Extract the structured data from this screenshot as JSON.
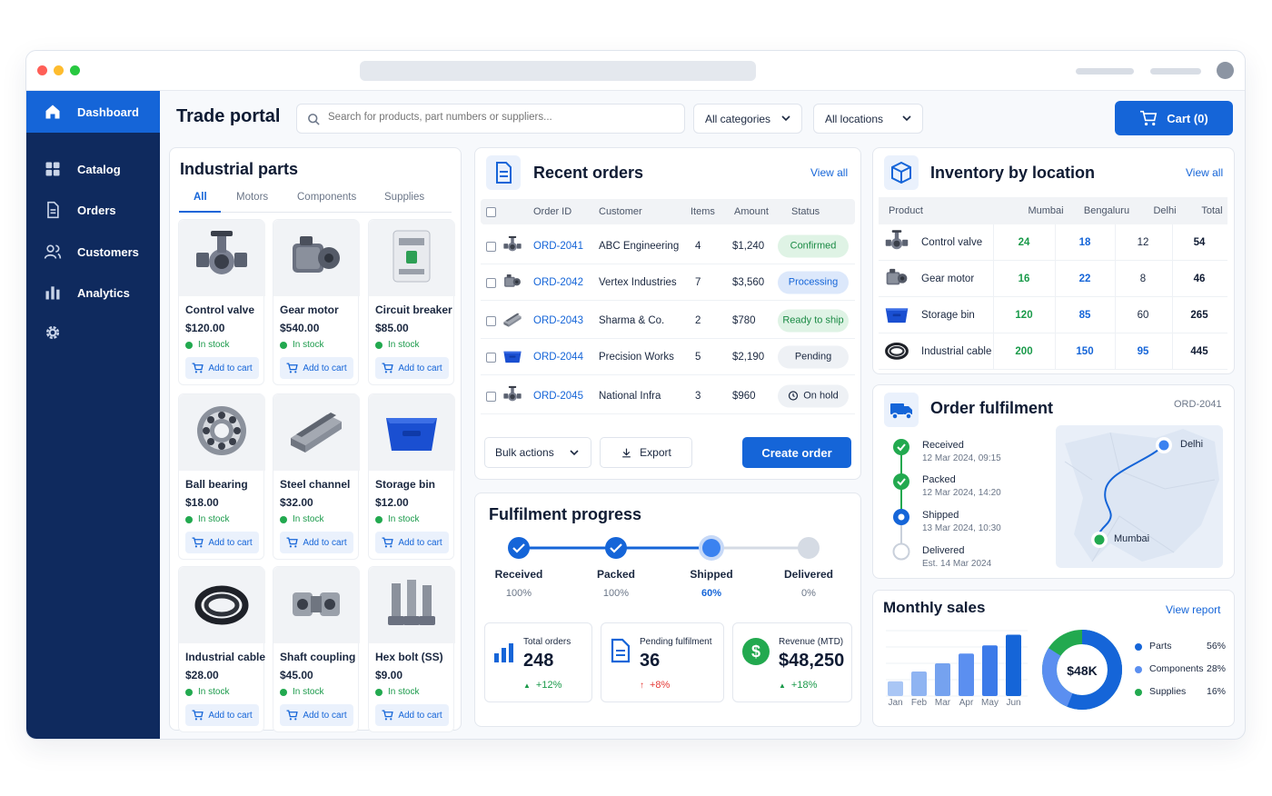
{
  "app": {
    "title": "Trade portal"
  },
  "search": {
    "placeholder": "Search for products, part numbers or suppliers..."
  },
  "filters": {
    "category": "All categories",
    "location": "All locations"
  },
  "cart": {
    "label": "Cart (0)"
  },
  "sidebar": {
    "items": [
      {
        "label": "Dashboard",
        "icon": "home-icon",
        "active": true
      },
      {
        "label": "Catalog",
        "icon": "grid-icon"
      },
      {
        "label": "Orders",
        "icon": "document-icon"
      },
      {
        "label": "Customers",
        "icon": "users-icon"
      },
      {
        "label": "Analytics",
        "icon": "bar-chart-icon"
      },
      {
        "label": "",
        "icon": "gear-icon"
      }
    ]
  },
  "parts": {
    "title": "Industrial parts",
    "tabs": [
      "All",
      "Motors",
      "Components",
      "Supplies"
    ],
    "stock_label": "In stock",
    "add_label": "Add to cart",
    "items": [
      {
        "name": "Control valve",
        "price": "$120.00",
        "icon": "valve-icon"
      },
      {
        "name": "Gear motor",
        "price": "$540.00",
        "icon": "motor-icon"
      },
      {
        "name": "Circuit breaker",
        "price": "$85.00",
        "icon": "breaker-icon"
      },
      {
        "name": "Ball bearing",
        "price": "$18.00",
        "icon": "bearing-icon"
      },
      {
        "name": "Steel channel",
        "price": "$32.00",
        "icon": "steel-channel-icon"
      },
      {
        "name": "Storage bin",
        "price": "$12.00",
        "icon": "storage-bin-icon"
      },
      {
        "name": "Industrial cable",
        "price": "$28.00",
        "icon": "cable-icon"
      },
      {
        "name": "Shaft coupling",
        "price": "$45.00",
        "icon": "coupling-icon"
      },
      {
        "name": "Hex bolt (SS)",
        "price": "$9.00",
        "icon": "bolt-icon"
      }
    ]
  },
  "orders": {
    "title": "Recent orders",
    "view_all": "View all",
    "columns": [
      "Order ID",
      "Customer",
      "Items",
      "Amount",
      "Status"
    ],
    "rows": [
      {
        "id": "ORD-2041",
        "customer": "ABC Engineering",
        "items": "4",
        "amount": "$1,240",
        "status": "Confirmed",
        "icon": "valve-icon"
      },
      {
        "id": "ORD-2042",
        "customer": "Vertex Industries",
        "items": "7",
        "amount": "$3,560",
        "status": "Processing",
        "icon": "motor-icon"
      },
      {
        "id": "ORD-2043",
        "customer": "Sharma & Co.",
        "items": "2",
        "amount": "$780",
        "status": "Ready to ship",
        "icon": "steel-channel-icon"
      },
      {
        "id": "ORD-2044",
        "customer": "Precision Works",
        "items": "5",
        "amount": "$2,190",
        "status": "Pending",
        "icon": "storage-bin-icon"
      },
      {
        "id": "ORD-2045",
        "customer": "National Infra",
        "items": "3",
        "amount": "$960",
        "status": "On hold",
        "icon": "valve-icon"
      }
    ],
    "bulk_label": "Bulk actions",
    "export_label": "Export",
    "create_label": "Create order"
  },
  "inventory": {
    "title": "Inventory by location",
    "view_all": "View all",
    "columns": [
      "Product",
      "Mumbai",
      "Bengaluru",
      "Delhi",
      "Total"
    ],
    "rows": [
      {
        "product": "Control valve",
        "mumbai": "24",
        "bengaluru": "18",
        "delhi": "12",
        "total": "54"
      },
      {
        "product": "Gear motor",
        "mumbai": "16",
        "bengaluru": "22",
        "delhi": "8",
        "total": "46"
      },
      {
        "product": "Storage bin",
        "mumbai": "120",
        "bengaluru": "85",
        "delhi": "60",
        "total": "265"
      },
      {
        "product": "Industrial cable",
        "mumbai": "200",
        "bengaluru": "150",
        "delhi": "95",
        "total": "445"
      }
    ]
  },
  "fulfilment": {
    "title": "Order fulfilment",
    "order_id": "ORD-2041",
    "steps": [
      {
        "name": "Received",
        "date": "12 Mar 2024, 09:15",
        "state": "done"
      },
      {
        "name": "Packed",
        "date": "12 Mar 2024, 14:20",
        "state": "done"
      },
      {
        "name": "Shipped",
        "date": "13 Mar 2024, 10:30",
        "state": "current"
      },
      {
        "name": "Delivered",
        "date": "Est. 14 Mar 2024",
        "state": "pending"
      }
    ],
    "map": {
      "origin": "Mumbai",
      "destination": "Delhi"
    }
  },
  "progress": {
    "title": "Fulfilment progress",
    "steps": [
      {
        "name": "Received",
        "pct": "100%",
        "state": "done"
      },
      {
        "name": "Packed",
        "pct": "100%",
        "state": "done"
      },
      {
        "name": "Shipped",
        "pct": "60%",
        "state": "current"
      },
      {
        "name": "Delivered",
        "pct": "0%",
        "state": "pending"
      }
    ],
    "kpis": [
      {
        "label": "Total orders",
        "value": "248",
        "delta": "+12%",
        "trend": "up"
      },
      {
        "label": "Pending fulfilment",
        "value": "36",
        "delta": "+8%",
        "trend": "up-red"
      },
      {
        "label": "Revenue (MTD)",
        "value": "$48,250",
        "delta": "+18%",
        "trend": "up"
      }
    ]
  },
  "sales": {
    "title": "Monthly sales",
    "view_report": "View report",
    "donut_center": "$48K",
    "legend": [
      {
        "name": "Parts",
        "pct": "56%",
        "color": "#1565d8"
      },
      {
        "name": "Components",
        "pct": "28%",
        "color": "#5b8ff0"
      },
      {
        "name": "Supplies",
        "pct": "16%",
        "color": "#22a94f"
      }
    ]
  },
  "chart_data": {
    "type": "bar",
    "categories": [
      "Jan",
      "Feb",
      "Mar",
      "Apr",
      "May",
      "Jun"
    ],
    "values": [
      18,
      30,
      40,
      52,
      62,
      75
    ],
    "title": "Monthly sales",
    "xlabel": "",
    "ylabel": "",
    "ylim": [
      0,
      80
    ],
    "grid": true
  },
  "colors": {
    "primary": "#1565d8",
    "navy": "#0f2a5e",
    "success": "#22a94f",
    "danger": "#e53935"
  }
}
